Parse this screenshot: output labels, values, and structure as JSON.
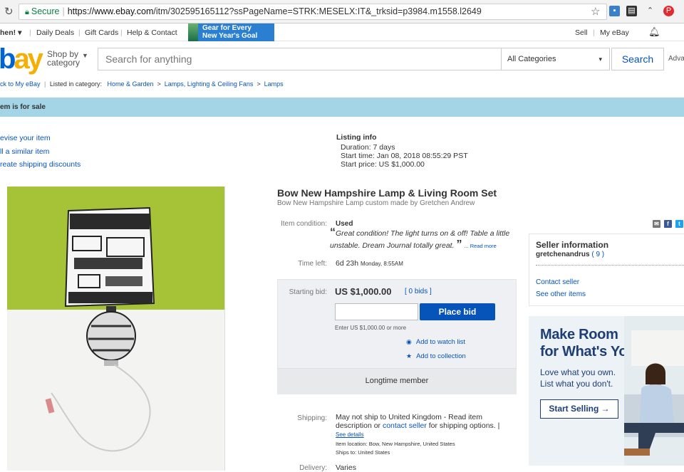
{
  "browser": {
    "secure_label": "Secure",
    "url_host": "https://www.ebay.com",
    "url_path": "/itm/302595165112?ssPageName=STRK:MESELX:IT&_trksid=p3984.m1558.l2649"
  },
  "topnav": {
    "greeting": "hen! ▾",
    "daily_deals": "Daily Deals",
    "gift_cards": "Gift Cards",
    "help": "Help & Contact",
    "promo_line1": "Gear for Every",
    "promo_line2": "New Year's Goal",
    "sell": "Sell",
    "my_ebay": "My eBay"
  },
  "header": {
    "logo_part1": "e",
    "logo_part2": "ay",
    "shop_by_line1": "Shop by",
    "shop_by_line2": "category",
    "search_placeholder": "Search for anything",
    "category": "All Categories",
    "search_button": "Search",
    "advanced": "Adva"
  },
  "breadcrumb": {
    "back": "ck to My eBay",
    "listed_in": "Listed in category:",
    "crumbs": [
      "Home & Garden",
      "Lamps, Lighting & Ceiling Fans",
      "Lamps"
    ]
  },
  "banner": {
    "text": "em is for sale"
  },
  "seller_links": [
    "evise your item",
    "ll a similar item",
    "reate shipping discounts"
  ],
  "listing_info": {
    "heading": "Listing info",
    "duration": "Duration:   7 days",
    "start_time": "Start time:  Jan 08, 2018 08:55:29 PST",
    "start_price": "Start price:  US $1,000.00"
  },
  "item": {
    "title": "Bow New Hampshire Lamp & Living Room Set",
    "subtitle": "Bow New Hampshire Lamp custom made by Gretchen Andrew",
    "condition_label": "Item condition:",
    "condition": "Used",
    "condition_quote": "Great condition! The light turns on & off! Table a little unstable. Dream Journal totally great.",
    "read_more": "Read more",
    "time_left_label": "Time left:",
    "time_left": "6d 23h",
    "time_left_detail": "Monday, 8:55AM"
  },
  "bid": {
    "label": "Starting bid:",
    "price": "US $1,000.00",
    "bids": "[ 0 bids ]",
    "place_bid": "Place bid",
    "hint": "Enter US $1,000.00 or more",
    "watch": "Add to watch list",
    "collection": "Add to collection",
    "longtime": "Longtime member"
  },
  "shipping": {
    "label": "Shipping:",
    "text_part1": "May not ship to United Kingdom - Read item description or",
    "contact_link": "contact seller",
    "text_part2": "for shipping options. |",
    "see_details": "See details",
    "item_location": "Item location:  Bow, New Hampshire, United States",
    "ships_to": "Ships to:  United States",
    "delivery_label": "Delivery:",
    "delivery": "Varies"
  },
  "seller": {
    "heading": "Seller information",
    "name": "gretchenandrus",
    "feedback": "( 9 )",
    "contact": "Contact seller",
    "other_items": "See other items"
  },
  "ad": {
    "headline_line1": "Make Room",
    "headline_line2": "for What's You",
    "sub_line1": "Love what you own.",
    "sub_line2": "List what you don't.",
    "button": "Start Selling →"
  },
  "colors": {
    "ebay_blue": "#0654ba",
    "banner": "#a3d5e7",
    "wall_green": "#a6c236"
  }
}
